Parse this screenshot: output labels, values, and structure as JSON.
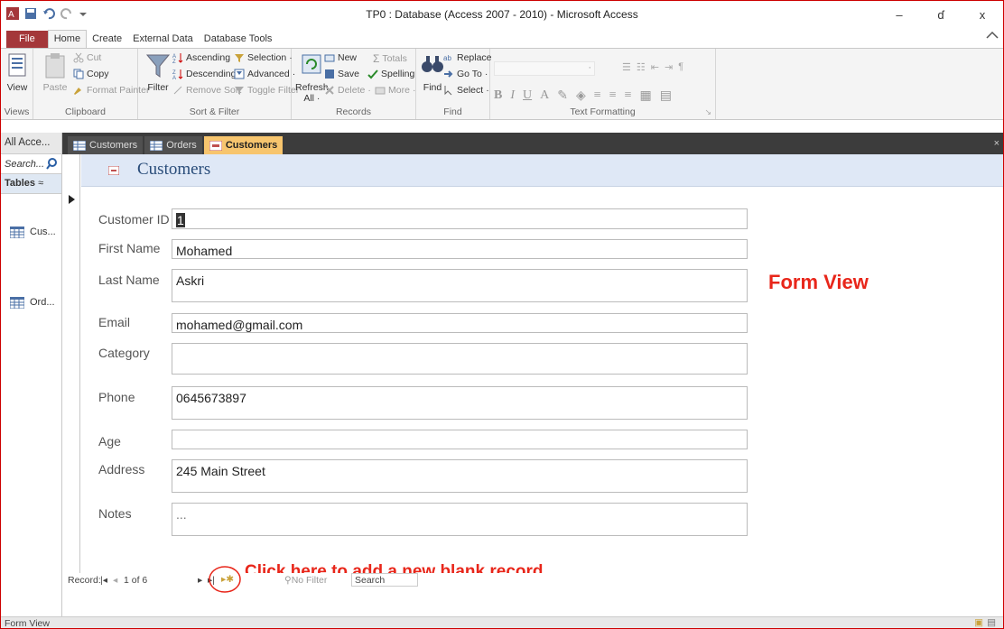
{
  "window": {
    "title": "TP0 : Database (Access 2007 - 2010) - Microsoft Access",
    "controls": {
      "minimize": "–",
      "restore": "ɗ",
      "close": "x"
    }
  },
  "ribbon_tabs": [
    "File",
    "Home",
    "Create",
    "External Data",
    "Database Tools"
  ],
  "ribbon": {
    "views": {
      "view": "View",
      "group": "Views"
    },
    "clipboard": {
      "paste": "Paste",
      "cut": "Cut",
      "copy": "Copy",
      "format_painter": "Format Painter",
      "group": "Clipboard"
    },
    "sort_filter": {
      "filter": "Filter",
      "ascending": "Ascending",
      "descending": "Descending",
      "remove_sort": "Remove Sort",
      "selection": "Selection",
      "advanced": "Advanced",
      "toggle_filter": "Toggle Filter",
      "group": "Sort & Filter"
    },
    "records": {
      "refresh": "Refresh",
      "all": "All",
      "new": "New",
      "save": "Save",
      "delete": "Delete",
      "totals": "Totals",
      "spelling": "Spelling",
      "more": "More",
      "group": "Records"
    },
    "find": {
      "find": "Find",
      "replace": "Replace",
      "goto": "Go To",
      "select": "Select",
      "group": "Find"
    },
    "text_formatting": {
      "group": "Text Formatting"
    }
  },
  "nav": {
    "header": "All Acce...",
    "search": "Search...",
    "section": "Tables",
    "items": [
      "Cus...",
      "Ord..."
    ]
  },
  "doc_tabs": [
    "Customers",
    "Orders",
    "Customers"
  ],
  "form": {
    "title": "Customers",
    "fields": [
      {
        "label": "Customer ID",
        "value": "1"
      },
      {
        "label": "First Name",
        "value": "Mohamed"
      },
      {
        "label": "Last Name",
        "value": "Askri"
      },
      {
        "label": "Email",
        "value": "mohamed@gmail.com"
      },
      {
        "label": "Category",
        "value": ""
      },
      {
        "label": "Phone",
        "value": "0645673897"
      },
      {
        "label": "Age",
        "value": ""
      },
      {
        "label": "Address",
        "value": "245 Main Street"
      },
      {
        "label": "Notes",
        "value": "..."
      }
    ]
  },
  "annotations": {
    "form_view": "Form View",
    "new_record": "Click here to add a new blank record"
  },
  "record_nav": {
    "label": "Record:",
    "position": "1 of 6",
    "filter": "No Filter",
    "search": "Search"
  },
  "status": {
    "left": "Form View"
  },
  "colors": {
    "accent": "#a4373a",
    "annotation": "#e8261a",
    "form_header": "#dfe8f6",
    "active_tab": "#f7c56e"
  }
}
